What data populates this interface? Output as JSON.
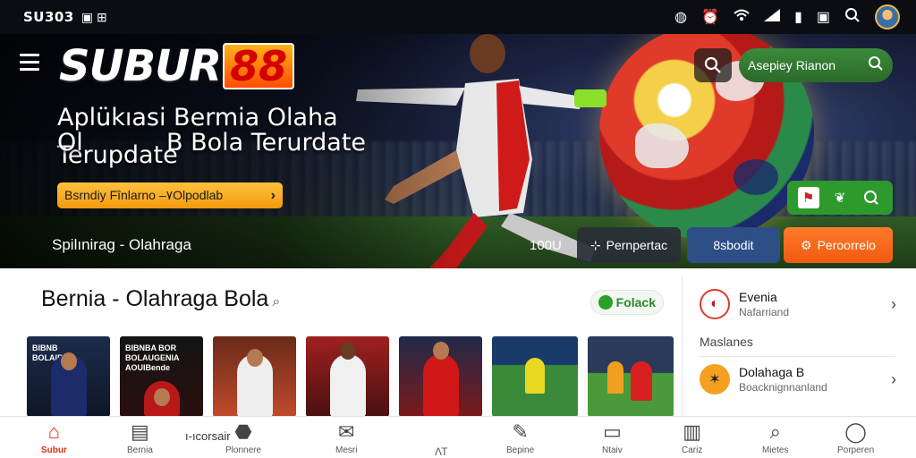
{
  "status_bar": {
    "time": "SU303",
    "left_icons": [
      "sim-icon",
      "notification-icon"
    ],
    "right_icons": [
      "alarm-icon",
      "clock-icon",
      "wifi-icon",
      "signal-icon",
      "battery-icon",
      "screenshot-icon",
      "search-icon"
    ]
  },
  "header": {
    "logo_word": "SUBUR",
    "logo_number": "88",
    "search_pill_label": "Asepiey Rianon"
  },
  "hero": {
    "title_line1": "Aplükıasi Bermia Olaha",
    "title_line2": "B Bola Terurdate",
    "title_line3": "Terupdate",
    "title_fragment": "Ol",
    "cta_label": "Bsrndiy Fînlarno –۷Olpodlab",
    "cta_arrow": "›",
    "subtitle": "Spilınirag - Olahraga",
    "count": "100U",
    "btn1": "Pernpertac",
    "btn2": "8sbodit",
    "btn3": "Peroorrelo"
  },
  "section": {
    "title": "Bernia - Olahraga Bola",
    "chip_label": "Folack",
    "cards": [
      {
        "caption": "BIBNB\nBOLAIBE"
      },
      {
        "caption": "BIBNBA BOR\nBOLAUGENIA\nAOUIBende"
      },
      {
        "caption": ""
      },
      {
        "caption": ""
      },
      {
        "caption": ""
      },
      {
        "caption": ""
      },
      {
        "caption": ""
      }
    ]
  },
  "side": {
    "item1_title": "Evenia",
    "item1_sub": "Nafarriand",
    "label": "Maslanes",
    "item2_title": "Dolahaga B",
    "item2_sub": "Boacknignnanland"
  },
  "bottom_nav": [
    {
      "label": "Subur",
      "icon": "home-icon"
    },
    {
      "label": "Bernia",
      "icon": "news-icon"
    },
    {
      "label": "Plonnere",
      "icon": "group-icon"
    },
    {
      "label": "Mesri",
      "icon": "mail-icon"
    },
    {
      "label": "",
      "icon": "ai-icon"
    },
    {
      "label": "Bepine",
      "icon": "feather-icon"
    },
    {
      "label": "Ntaiv",
      "icon": "tv-icon"
    },
    {
      "label": "Cariz",
      "icon": "chart-icon"
    },
    {
      "label": "Mietes",
      "icon": "search-icon"
    },
    {
      "label": "Porperen",
      "icon": "profile-icon"
    }
  ],
  "bottom_extra_label": "ı-ıcorsair",
  "colors": {
    "brand_orange": "#f05a10",
    "brand_green": "#2e9a2e",
    "cta_yellow": "#f6b02a"
  }
}
